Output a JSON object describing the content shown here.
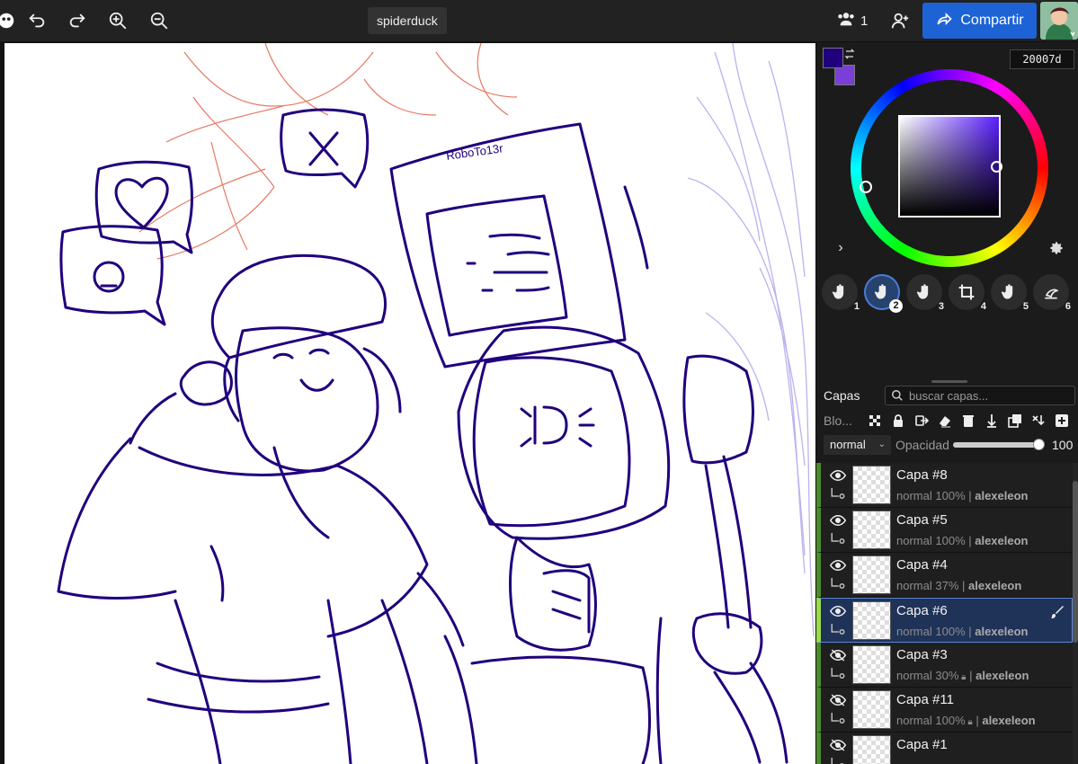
{
  "toolbar": {
    "doc_title": "spiderduck",
    "users_count": "1",
    "share_label": "Compartir",
    "icons": [
      "app-menu-icon",
      "undo-icon",
      "redo-icon",
      "zoom-in-icon",
      "zoom-out-icon",
      "users-icon",
      "add-user-icon",
      "share-icon"
    ]
  },
  "color": {
    "hex": "20007d",
    "primary": "#20007d",
    "secondary": "#7a3fd6"
  },
  "brushes": [
    {
      "num": "1",
      "active": false
    },
    {
      "num": "2",
      "active": true
    },
    {
      "num": "3",
      "active": false
    },
    {
      "num": "4",
      "active": false
    },
    {
      "num": "5",
      "active": false
    },
    {
      "num": "6",
      "active": false
    }
  ],
  "layers_panel": {
    "title": "Capas",
    "search_placeholder": "buscar capas...",
    "blend_label": "Blo...",
    "mode": "normal",
    "opacity_label": "Opacidad",
    "opacity_value": "100",
    "opacity_fraction": 1.0
  },
  "layers": [
    {
      "name": "Capa #8",
      "mode": "normal",
      "opacity": "100%",
      "locked": false,
      "user": "alexeleon",
      "visible": true
    },
    {
      "name": "Capa #5",
      "mode": "normal",
      "opacity": "100%",
      "locked": false,
      "user": "alexeleon",
      "visible": true
    },
    {
      "name": "Capa #4",
      "mode": "normal",
      "opacity": "37%",
      "locked": false,
      "user": "alexeleon",
      "visible": true
    },
    {
      "name": "Capa #6",
      "mode": "normal",
      "opacity": "100%",
      "locked": false,
      "user": "alexeleon",
      "visible": true,
      "selected": true
    },
    {
      "name": "Capa #3",
      "mode": "normal",
      "opacity": "30%",
      "locked": true,
      "user": "alexeleon",
      "visible": false
    },
    {
      "name": "Capa #11",
      "mode": "normal",
      "opacity": "100%",
      "locked": true,
      "user": "alexeleon",
      "visible": false
    },
    {
      "name": "Capa #1",
      "mode": "",
      "opacity": "",
      "locked": false,
      "user": "",
      "visible": false
    }
  ],
  "canvas": {
    "screen_text": "RoboTo13r",
    "colors": {
      "ink": "#20007d",
      "sketch_red": "#e0583c",
      "sketch_lavender": "#b9b3f0"
    }
  }
}
